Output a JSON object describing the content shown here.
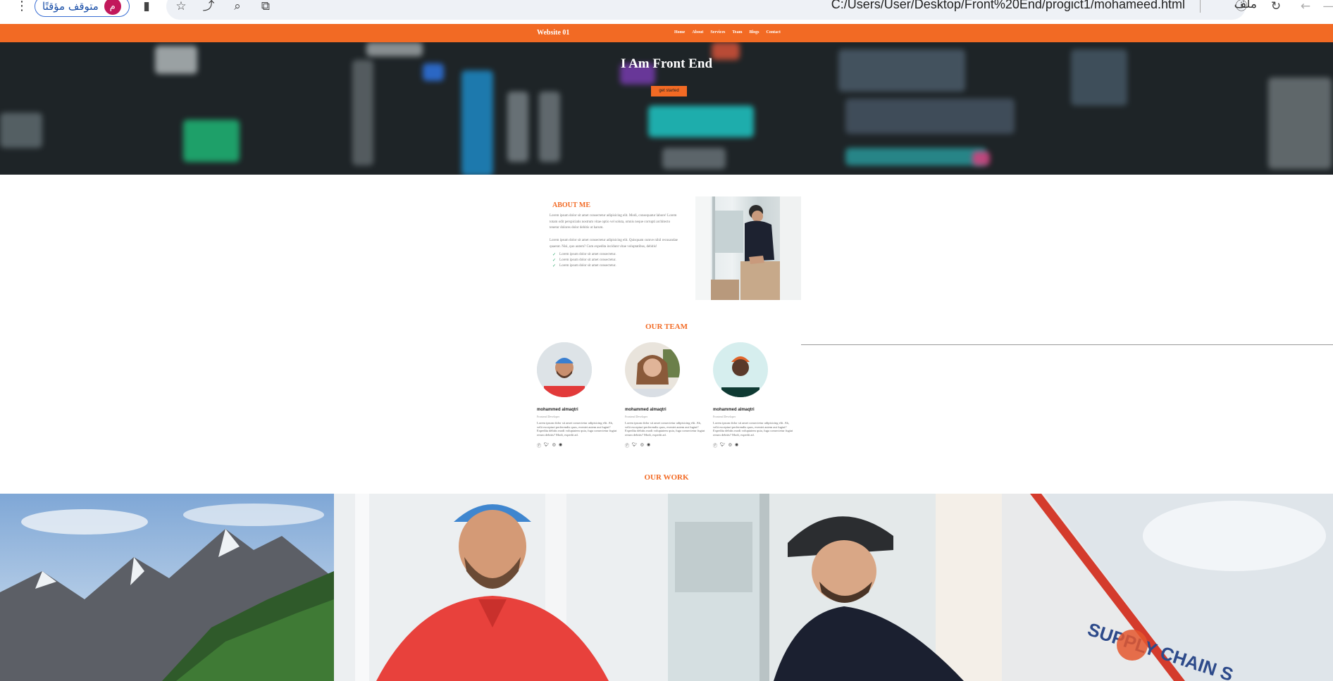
{
  "browser": {
    "pause_label": "متوقف مؤقتًا",
    "avatar_letter": "م",
    "url": "C:/Users/User/Desktop/Front%20End/progict1/mohameed.html",
    "file_label": "ملف"
  },
  "nav": {
    "brand": "Website 01",
    "links": [
      "Home",
      "About",
      "Services",
      "Team",
      "Blogs",
      "Contact"
    ]
  },
  "hero": {
    "title": "I Am Front End",
    "cta": "get started"
  },
  "about": {
    "title": "ABOUT ME",
    "p1": "Lorem ipsum dolor sit amet consectetur adipisicing elit. Modi, consequatur labore! Lorem totam odit perspiciatis nostrum vitae optio vel soluta, omnis neque corrupti architecto tenetur dolores dolor debitis ut harum.",
    "p2": "Lorem ipsum dolor sit amet consectetur adipisicing elit. Quisquam cumve nihil recusandae quaerat. Nisi, quo autem? Cum expedita incidunt vitae voluptatibus, debitis!",
    "items": [
      "Lorem ipsum dolor sit amet consectetur.",
      "Lorem ipsum dolor sit amet consectetur.",
      "Lorem ipsum dolor sit amet consectetur."
    ]
  },
  "team": {
    "title": "OUR TEAM",
    "members": [
      {
        "name": "mohammed almaqtri",
        "role": "Frontend Developer",
        "bio": "Lorem ipsum dolor sit amet consectetur adipisicing elit. Ab, velit excepturi perferendis quos, eveniet autem aut fugiat? Expedita debitis modi voluptatem quia, fuga consectetur fugiat rerum debitis? Modi, expedit ad."
      },
      {
        "name": "mohammed almaqtri",
        "role": "Frontend Developer",
        "bio": "Lorem ipsum dolor sit amet consectetur adipisicing elit. Ab, velit excepturi perferendis quos, eveniet autem aut fugiat? Expedita debitis modi voluptatem quia, fuga consectetur fugiat rerum debitis? Modi, expedit ad."
      },
      {
        "name": "mohammed almaqtri",
        "role": "Frontend Developer",
        "bio": "Lorem ipsum dolor sit amet consectetur adipisicing elit. Ab, velit excepturi perferendis quos, eveniet autem aut fugiat? Expedita debitis modi voluptatem quia, fuga consectetur fugiat rerum debitis? Modi, expedit ad."
      }
    ]
  },
  "work": {
    "title": "OUR WORK",
    "truck_text": "SUPPLY CHAIN S"
  },
  "colors": {
    "accent": "#f26a24",
    "hero_bg": "#1e2427"
  }
}
